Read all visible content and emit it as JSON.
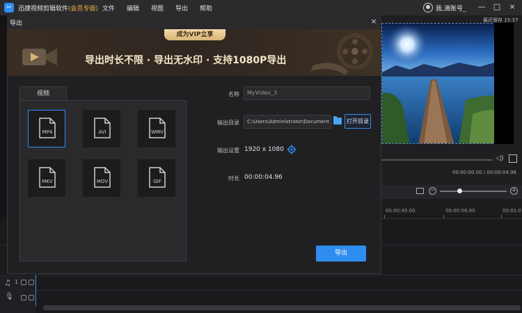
{
  "app": {
    "logo_glyph": "✂",
    "name_prefix": "迅捷视频剪辑软件",
    "name_vip": "(会员专版)",
    "menu": [
      "文件",
      "编辑",
      "视图",
      "导出",
      "帮助"
    ],
    "user_name": "我,滴账号_",
    "window_buttons": {
      "minimize": "—",
      "maximize": "□",
      "close": "×"
    }
  },
  "preview": {
    "save_time": "最近保存 15:37",
    "time_readout": "00:00:00.00 / 00:00:04.96"
  },
  "timeline": {
    "ruler_labels": [
      "00:00:45.00",
      "00:00:56.00",
      "00:01:0"
    ],
    "track_number": "1"
  },
  "dialog": {
    "title": "导出",
    "close_glyph": "×",
    "banner": {
      "tag": "成为VIP立享",
      "headline": "导出时长不限 · 导出无水印 · 支持1080P导出"
    },
    "format_tab": "视频",
    "formats": [
      {
        "label": "MP4",
        "selected": true
      },
      {
        "label": "AVI",
        "selected": false
      },
      {
        "label": "WMV",
        "selected": false
      },
      {
        "label": "MKV",
        "selected": false
      },
      {
        "label": "MOV",
        "selected": false
      },
      {
        "label": "GIF",
        "selected": false
      }
    ],
    "form": {
      "name_label": "名称",
      "name_value": "MyVideo_3",
      "dir_label": "输出目录",
      "dir_value": "C:\\Users\\Administrator\\Document",
      "open_dir_button": "打开目录",
      "settings_label": "输出设置",
      "settings_value": "1920 x 1080",
      "duration_label": "时长",
      "duration_value": "00:00:04.96"
    },
    "export_button": "导出"
  },
  "colors": {
    "accent": "#2f8cf0",
    "vip_gold": "#f3b33c",
    "dialog_bg": "#202023"
  }
}
